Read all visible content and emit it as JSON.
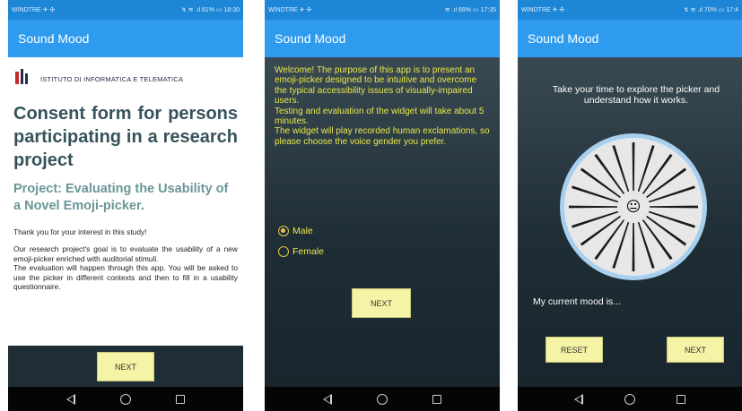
{
  "phones": [
    {
      "status": {
        "carrier": "WINDTRE ✈ ✣",
        "right": "↯ ≋ .ıl 81% ▭ 18:30"
      },
      "app_title": "Sound Mood",
      "logo_text": "ISTITUTO DI INFORMATICA E TELEMATICA",
      "title": "Consent form for persons participating in a research project",
      "subtitle": "Project: Evaluating the Usability of a Novel Emoji-picker.",
      "para1": "Thank you for your interest in this study!",
      "para2": "Our research project's goal is to evaluate the usability of a new emoji-picker enriched with auditorial stimuli.",
      "para3": "The evaluation will happen through this app. You will be asked to use the picker in different contexts and then to fill in a usability questionnaire.",
      "next_label": "NEXT"
    },
    {
      "status": {
        "carrier": "WINDTRE ✈ ✣",
        "right": "≋ .ıl 69% ▭ 17:35"
      },
      "app_title": "Sound Mood",
      "welcome": "Welcome! The purpose of this app is to present an emoji-picker designed to be intuitive and overcome the typical accessibility issues of visually-impaired users.\nTesting and evaluation of the widget will take about 5 minutes.\nThe widget will play recorded human exclamations, so please choose the voice gender you prefer.",
      "options": [
        {
          "label": "Male",
          "selected": true
        },
        {
          "label": "Female",
          "selected": false
        }
      ],
      "next_label": "NEXT"
    },
    {
      "status": {
        "carrier": "WINDTRE ✈ ✣",
        "right": "↯ ≋ .ıl 70% ▭ 17:4"
      },
      "app_title": "Sound Mood",
      "instruction": "Take your time to explore the picker and understand how it works.",
      "mood_label": "My current mood is...",
      "reset_label": "RESET",
      "next_label": "NEXT",
      "center_emoji": "😐"
    }
  ],
  "colors": {
    "status_bar": "#1e86d6",
    "app_bar": "#2f9bef",
    "accent_yellow": "#e8e84a",
    "button_bg": "#f4f3a6",
    "title_text": "#36535c",
    "subtitle_text": "#6b9598",
    "picker_ring": "#a8d0ee",
    "picker_face": "#e7e7e7"
  }
}
